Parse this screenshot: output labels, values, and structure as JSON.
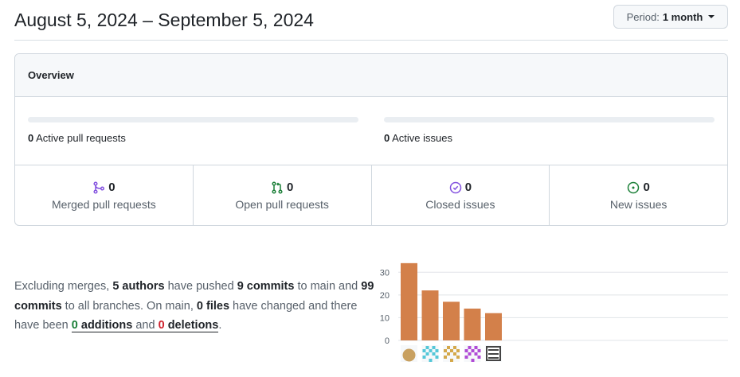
{
  "header": {
    "title": "August 5, 2024 – September 5, 2024",
    "period_label": "Period:",
    "period_value": "1 month"
  },
  "overview": {
    "title": "Overview",
    "active_prs": {
      "count": "0",
      "label": "Active pull requests",
      "progress": 0
    },
    "active_issues": {
      "count": "0",
      "label": "Active issues",
      "progress": 0
    },
    "stats": [
      {
        "icon": "merged-pr-icon",
        "count": "0",
        "label": "Merged pull requests",
        "color": "#8250df"
      },
      {
        "icon": "open-pr-icon",
        "count": "0",
        "label": "Open pull requests",
        "color": "#1a7f37"
      },
      {
        "icon": "closed-issue-icon",
        "count": "0",
        "label": "Closed issues",
        "color": "#8250df"
      },
      {
        "icon": "open-issue-icon",
        "count": "0",
        "label": "New issues",
        "color": "#1a7f37"
      }
    ]
  },
  "summary": {
    "p1": "Excluding merges,",
    "authors": "5 authors",
    "p2": "have pushed",
    "commits_main": "9 commits",
    "p3": "to main and",
    "commits_all": "99 commits",
    "p4": "to all branches. On main,",
    "files": "0 files",
    "p5": "have changed and there have been",
    "additions_num": "0",
    "additions_word": "additions",
    "and": "and",
    "deletions_num": "0",
    "deletions_word": "deletions",
    "end": "."
  },
  "chart_data": {
    "type": "bar",
    "categories": [
      "author-1",
      "author-2",
      "author-3",
      "author-4",
      "author-5"
    ],
    "values": [
      34,
      22,
      17,
      14,
      12
    ],
    "yticks": [
      "0",
      "10",
      "20",
      "30"
    ],
    "ylim": [
      0,
      35
    ],
    "grid": true,
    "bar_color": "#d3804a",
    "avatar_colors": [
      "#c8a060",
      "#54c7d8",
      "#d4a84a",
      "#b04bd6",
      "#444444"
    ]
  }
}
